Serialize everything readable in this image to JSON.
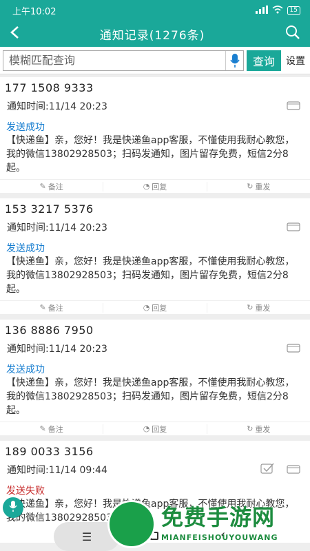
{
  "status_bar": {
    "time": "上午10:02",
    "battery": "15"
  },
  "header": {
    "title": "通知记录(1276条)"
  },
  "search": {
    "placeholder": "模糊匹配查询",
    "query_label": "查询",
    "settings_label": "设置"
  },
  "records": [
    {
      "phone": "177 1508 9333",
      "time": "通知时间:11/14 20:23",
      "status": "发送成功",
      "message": "【快递鱼】亲，您好！我是快递鱼app客服，不懂使用我耐心教您，我的微信13802928503；扫码发通知，图片留存免费，短信2分8起。",
      "actions": [
        "备注",
        "回复",
        "重发"
      ]
    },
    {
      "phone": "153 3217 5376",
      "time": "通知时间:11/14 20:23",
      "status": "发送成功",
      "message": "【快递鱼】亲，您好！我是快递鱼app客服，不懂使用我耐心教您，我的微信13802928503；扫码发通知，图片留存免费，短信2分8起。",
      "actions": [
        "备注",
        "回复",
        "重发"
      ]
    },
    {
      "phone": "136 8886 7950",
      "time": "通知时间:11/14 20:23",
      "status": "发送成功",
      "message": "【快递鱼】亲，您好！我是快递鱼app客服，不懂使用我耐心教您，我的微信13802928503；扫码发通知，图片留存免费，短信2分8起。",
      "actions": [
        "备注",
        "回复",
        "重发"
      ]
    },
    {
      "phone": "189 0033 3156",
      "time": "通知时间:11/14 09:44",
      "status": "发送失败",
      "message": "【快递鱼】亲，您好！我是快递鱼app客服，不懂使用我耐心教您，我的微信13802928503",
      "actions": []
    }
  ],
  "watermark": {
    "title": "免费手游网",
    "subtitle": "MIANFEISHOUYOUWANG"
  },
  "colors": {
    "accent": "#1aa899",
    "success": "#1a7fd0",
    "failure": "#c62828"
  }
}
